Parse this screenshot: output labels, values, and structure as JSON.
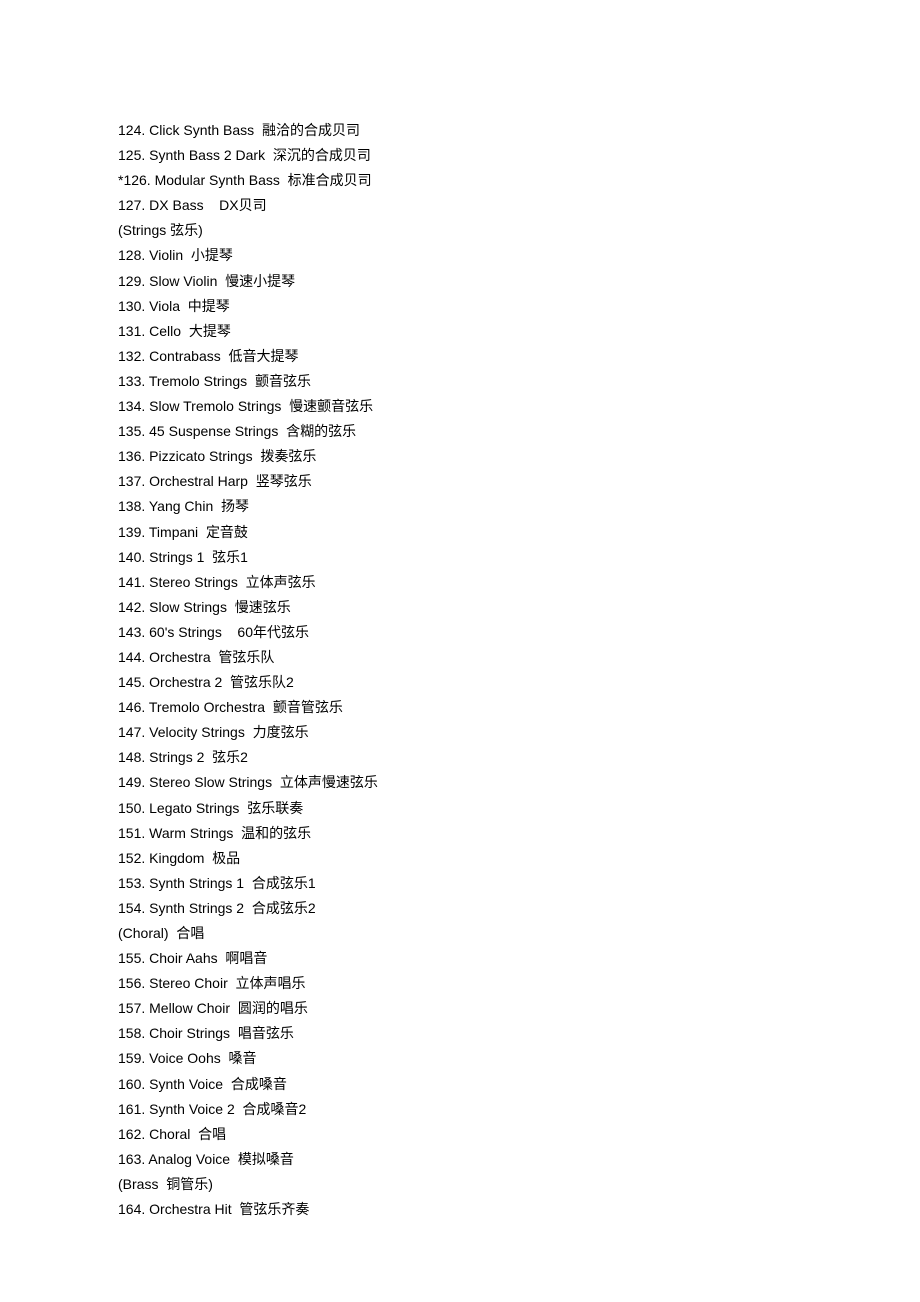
{
  "lines": [
    "124. Click Synth Bass  融洽的合成贝司",
    "125. Synth Bass 2 Dark  深沉的合成贝司",
    "*126. Modular Synth Bass  标准合成贝司",
    "127. DX Bass    DX贝司",
    "(Strings 弦乐)",
    "128. Violin  小提琴",
    "129. Slow Violin  慢速小提琴",
    "130. Viola  中提琴",
    "131. Cello  大提琴",
    "132. Contrabass  低音大提琴",
    "133. Tremolo Strings  颤音弦乐",
    "134. Slow Tremolo Strings  慢速颤音弦乐",
    "135. 45 Suspense Strings  含糊的弦乐",
    "136. Pizzicato Strings  拨奏弦乐",
    "137. Orchestral Harp  竖琴弦乐",
    "138. Yang Chin  扬琴",
    "139. Timpani  定音鼓",
    "140. Strings 1  弦乐1",
    "141. Stereo Strings  立体声弦乐",
    "142. Slow Strings  慢速弦乐",
    "143. 60's Strings    60年代弦乐",
    "144. Orchestra  管弦乐队",
    "145. Orchestra 2  管弦乐队2",
    "146. Tremolo Orchestra  颤音管弦乐",
    "147. Velocity Strings  力度弦乐",
    "148. Strings 2  弦乐2",
    "149. Stereo Slow Strings  立体声慢速弦乐",
    "150. Legato Strings  弦乐联奏",
    "151. Warm Strings  温和的弦乐",
    "152. Kingdom  极品",
    "153. Synth Strings 1  合成弦乐1",
    "154. Synth Strings 2  合成弦乐2",
    "(Choral)  合唱",
    "155. Choir Aahs  啊唱音",
    "156. Stereo Choir  立体声唱乐",
    "157. Mellow Choir  圆润的唱乐",
    "158. Choir Strings  唱音弦乐",
    "159. Voice Oohs  嗓音",
    "160. Synth Voice  合成嗓音",
    "161. Synth Voice 2  合成嗓音2",
    "162. Choral  合唱",
    "163. Analog Voice  模拟嗓音",
    "(Brass  铜管乐)",
    "164. Orchestra Hit  管弦乐齐奏"
  ]
}
